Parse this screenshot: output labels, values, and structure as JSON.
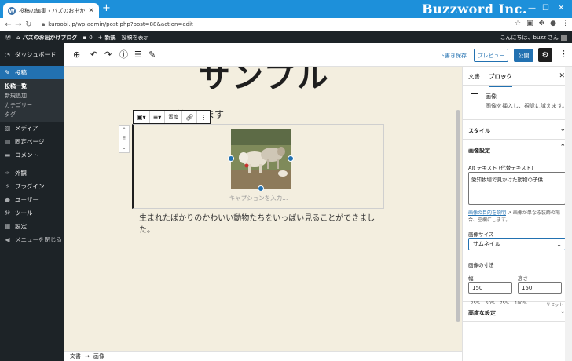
{
  "browser": {
    "tab_title": "投稿の編集 ‹ バズのお出かけブログ",
    "url": "kuroobi.jp/wp-admin/post.php?post=88&action=edit",
    "brand": "Buzzword Inc."
  },
  "adminbar": {
    "site_name": "バズのお出かけブログ",
    "comments": "0",
    "new_label": "新規",
    "view_post": "投稿を表示",
    "greeting": "こんにちは、buzz さん"
  },
  "menu": {
    "dashboard": "ダッシュボード",
    "posts": "投稿",
    "sub": [
      "投稿一覧",
      "新規追加",
      "カテゴリー",
      "タグ"
    ],
    "media": "メディア",
    "pages": "固定ページ",
    "comments": "コメント",
    "appearance": "外観",
    "plugins": "プラグイン",
    "users": "ユーザー",
    "tools": "ツール",
    "settings": "設定",
    "collapse": "メニューを閉じる"
  },
  "toolbar": {
    "save_draft": "下書き保存",
    "preview": "プレビュー",
    "publish": "公開"
  },
  "content": {
    "title_partial": "サンプル",
    "partial_text": "ここから始まります",
    "replace_label": "置換",
    "caption_placeholder": "キャプションを入力...",
    "paragraph": "生まれたばかりのかわいい動物たちをいっぱい見ることができました。"
  },
  "statusbar": {
    "doc": "文書",
    "sep": "→",
    "block": "画像"
  },
  "sidebar": {
    "tab_document": "文書",
    "tab_block": "ブロック",
    "block_name": "画像",
    "block_desc": "画像を挿入し、視覚に訴えます。",
    "style_panel": "スタイル",
    "image_settings": "画像設定",
    "alt_label": "Alt テキスト (代替テキスト)",
    "alt_value": "愛知牧場で見かけた動物の子供",
    "help_link": "画像の目的を説明",
    "help_text": "画像が単なる装飾の場合、空欄にします。",
    "size_label": "画像サイズ",
    "size_value": "サムネイル",
    "dims_label": "画像の寸法",
    "width_label": "幅",
    "height_label": "高さ",
    "width_value": "150",
    "height_value": "150",
    "percents": [
      "25%",
      "50%",
      "75%",
      "100%"
    ],
    "reset": "リセット",
    "advanced": "高度な設定"
  }
}
